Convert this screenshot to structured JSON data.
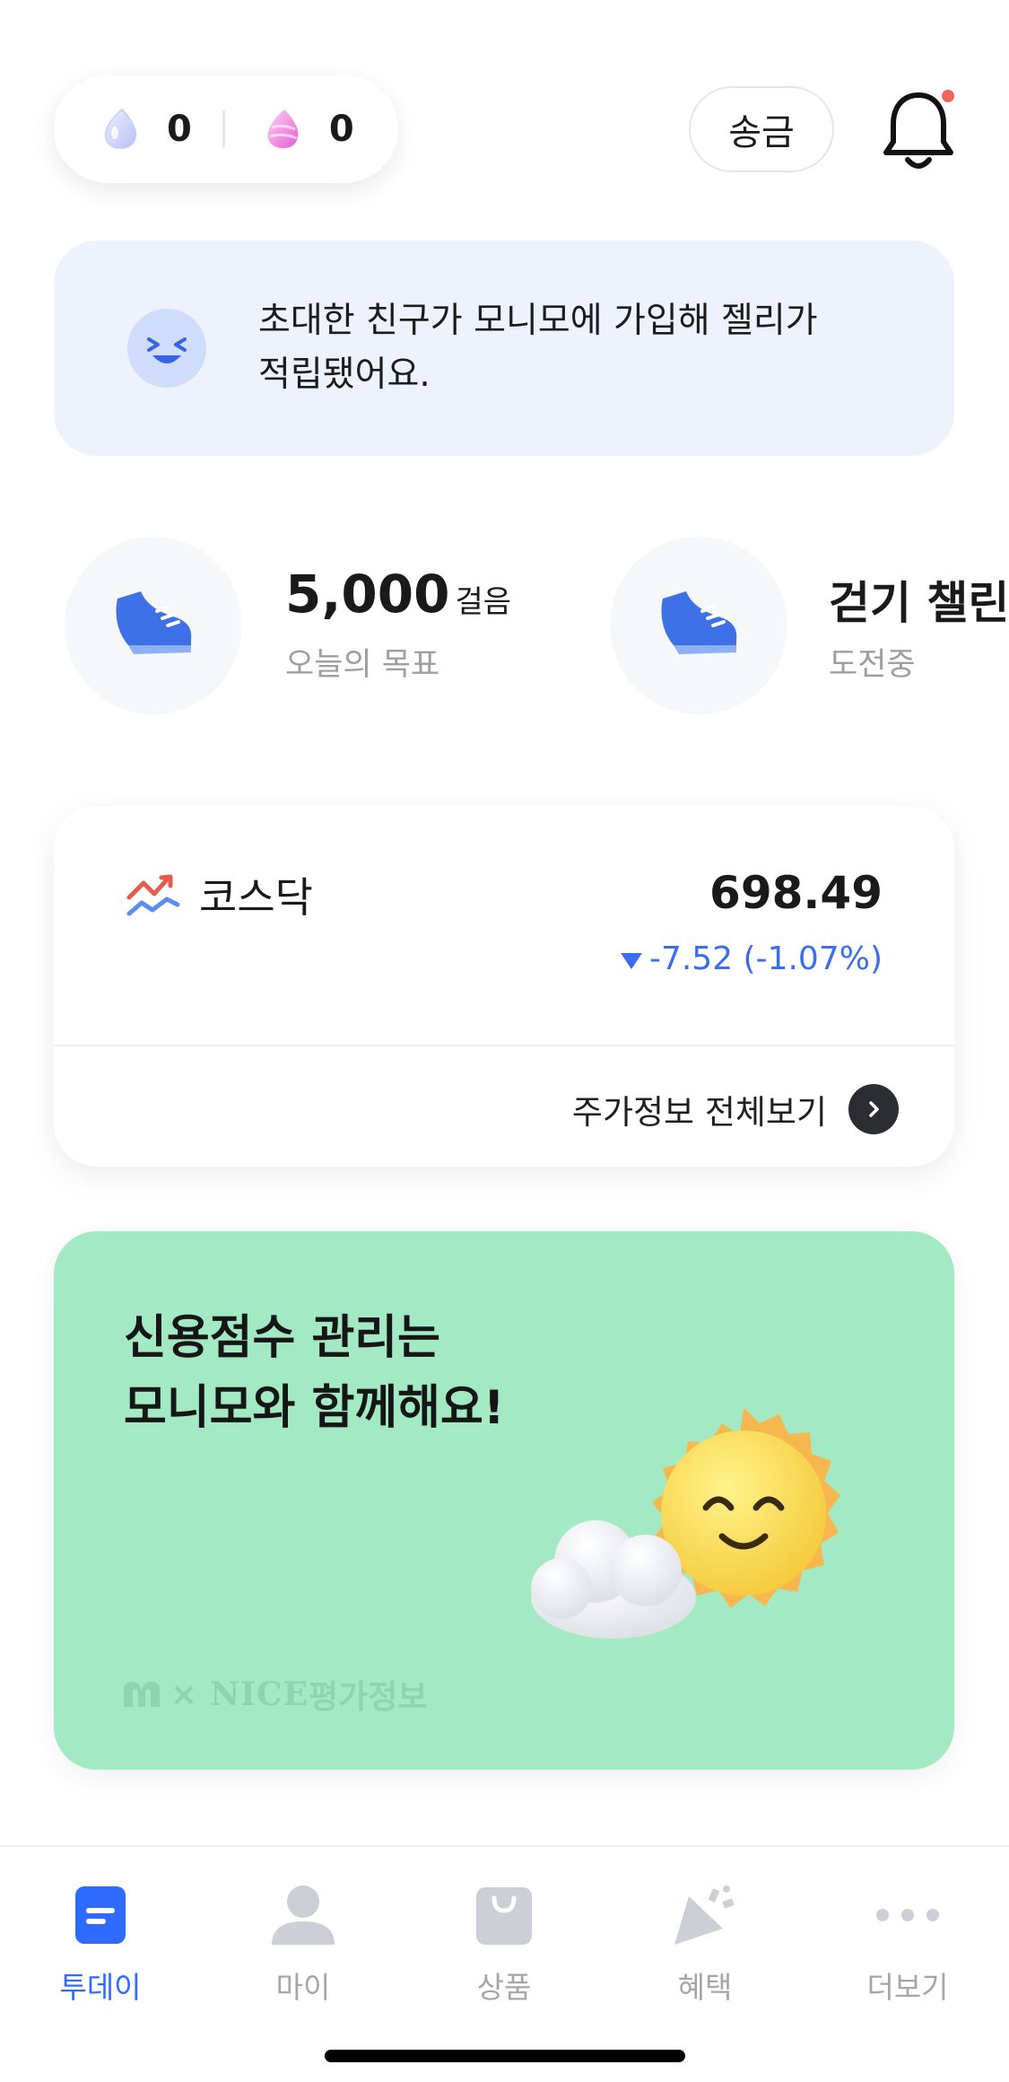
{
  "top_bar": {
    "jellies": [
      {
        "icon": "blue-jelly-icon",
        "count": "0"
      },
      {
        "icon": "pink-jelly-icon",
        "count": "0"
      }
    ],
    "send_label": "송금",
    "bell_icon": "bell-icon"
  },
  "notice": {
    "icon": "laughing-face-icon",
    "line1": "초대한 친구가 모니모에 가입해 젤리가",
    "line2": "적립됐어요."
  },
  "walking": [
    {
      "main": "5,000",
      "unit": "걸음",
      "sub": "오늘의 목표",
      "icon": "sneaker-icon"
    },
    {
      "main": "걷기 챌린지",
      "sub": "도전중",
      "icon": "sneaker-icon"
    }
  ],
  "stock": {
    "icon": "stock-chart-icon",
    "name": "코스닥",
    "value": "698.49",
    "change": "-7.52 (-1.07%)",
    "more_label": "주가정보 전체보기"
  },
  "credit_banner": {
    "title_line1": "신용점수 관리는",
    "title_line2": "모니모와 함께해요!",
    "footer_x": "×",
    "footer_brand": "NICE",
    "footer_partner": "평가정보"
  },
  "bottom_nav": [
    {
      "label": "투데이",
      "icon": "today-icon",
      "active": true
    },
    {
      "label": "마이",
      "icon": "person-icon",
      "active": false
    },
    {
      "label": "상품",
      "icon": "shopping-bag-icon",
      "active": false
    },
    {
      "label": "혜택",
      "icon": "party-popper-icon",
      "active": false
    },
    {
      "label": "더보기",
      "icon": "more-dots-icon",
      "active": false
    }
  ],
  "colors": {
    "accent": "#2f6bff",
    "notice_bg": "#eef2fc",
    "banner_bg": "#a3e9c3",
    "change_down": "#3a6df0",
    "badge": "#f0645a"
  }
}
